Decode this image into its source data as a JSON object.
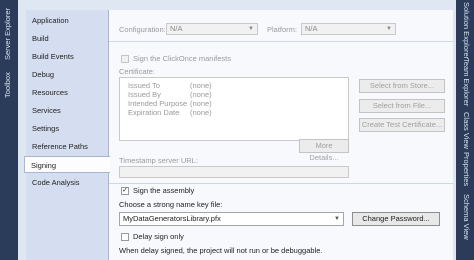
{
  "left_toolwindows": [
    "Server Explorer",
    "Toolbox"
  ],
  "right_toolwindows": [
    "Solution Explorer",
    "Team Explorer",
    "Class View",
    "Properties",
    "Schema View"
  ],
  "nav": {
    "items": [
      "Application",
      "Build",
      "Build Events",
      "Debug",
      "Resources",
      "Services",
      "Settings",
      "Reference Paths",
      "Signing",
      "Code Analysis"
    ],
    "selected": "Signing"
  },
  "config": {
    "configuration_label": "Configuration:",
    "configuration_value": "N/A",
    "platform_label": "Platform:",
    "platform_value": "N/A"
  },
  "clickonce": {
    "sign_label": "Sign the ClickOnce manifests",
    "certificate_label": "Certificate:",
    "fields": [
      {
        "label": "Issued To",
        "value": "(none)"
      },
      {
        "label": "Issued By",
        "value": "(none)"
      },
      {
        "label": "Intended Purpose",
        "value": "(none)"
      },
      {
        "label": "Expiration Date",
        "value": "(none)"
      }
    ],
    "select_from_store": "Select from Store...",
    "select_from_file": "Select from File...",
    "create_test_cert": "Create Test Certificate...",
    "more_details": "More Details...",
    "timestamp_label": "Timestamp server URL:"
  },
  "assembly": {
    "sign_label": "Sign the assembly",
    "sign_checked": true,
    "key_label": "Choose a strong name key file:",
    "key_value": "MyDataGeneratorsLibrary.pfx",
    "change_password": "Change Password...",
    "delay_label": "Delay sign only",
    "delay_checked": false,
    "delay_note": "When delay signed, the project will not run or be debuggable."
  },
  "colors": {
    "chrome": "#2b3c5a",
    "page": "#f7f9fc",
    "nav": "#d4def0"
  }
}
